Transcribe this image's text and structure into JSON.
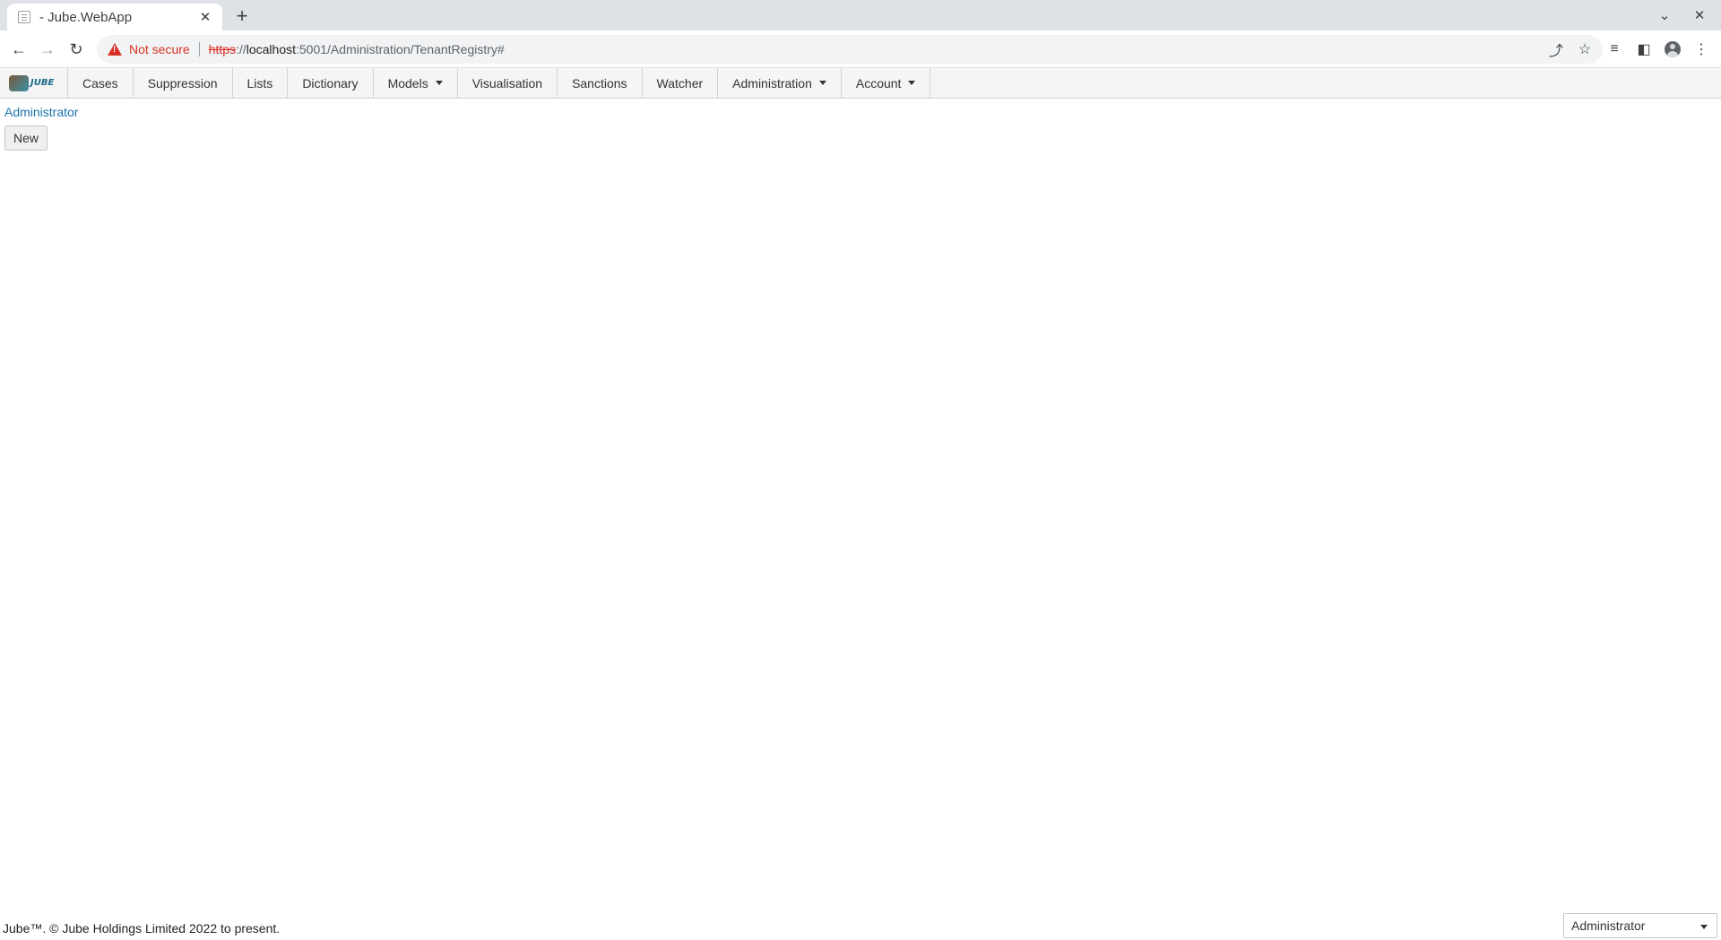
{
  "browser": {
    "tab_title": "- Jube.WebApp",
    "tab_close_glyph": "✕",
    "new_tab_glyph": "+",
    "security_label": "Not secure",
    "url_scheme": "https",
    "url_host": "localhost",
    "url_rest": ":5001/Administration/TenantRegistry#",
    "icons": {
      "back": "←",
      "forward": "→",
      "reload": "↻",
      "share": "⤴",
      "bookmark": "☆",
      "media": "≡",
      "sidepanel": "◧",
      "menu": "⋮",
      "chevron": "⌄",
      "close": "✕"
    }
  },
  "nav": {
    "logo_text": "JUBE",
    "items": [
      {
        "label": "Cases",
        "dropdown": false
      },
      {
        "label": "Suppression",
        "dropdown": false
      },
      {
        "label": "Lists",
        "dropdown": false
      },
      {
        "label": "Dictionary",
        "dropdown": false
      },
      {
        "label": "Models",
        "dropdown": true
      },
      {
        "label": "Visualisation",
        "dropdown": false
      },
      {
        "label": "Sanctions",
        "dropdown": false
      },
      {
        "label": "Watcher",
        "dropdown": false
      },
      {
        "label": "Administration",
        "dropdown": true
      },
      {
        "label": "Account",
        "dropdown": true
      }
    ]
  },
  "content": {
    "breadcrumb": "Administrator",
    "new_button": "New"
  },
  "footer": {
    "copyright": "Jube™. © Jube Holdings Limited 2022 to present.",
    "role_selected": "Administrator"
  }
}
